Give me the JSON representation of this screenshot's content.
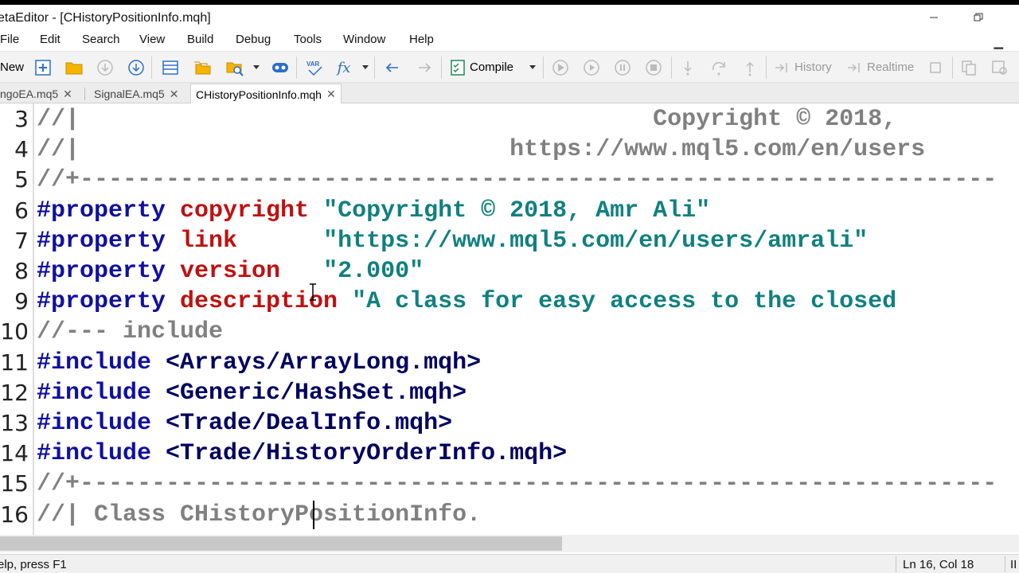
{
  "window": {
    "title": "etaEditor - [CHistoryPositionInfo.mqh]"
  },
  "menu": [
    "File",
    "Edit",
    "Search",
    "View",
    "Build",
    "Debug",
    "Tools",
    "Window",
    "Help"
  ],
  "toolbar": {
    "new_label": "New",
    "compile_label": "Compile",
    "history_label": "History",
    "realtime_label": "Realtime",
    "var_badge": "VAR",
    "fx_badge": "fx"
  },
  "tabs": [
    {
      "label": "ngoEA.mq5",
      "active": false
    },
    {
      "label": "SignalEA.mq5",
      "active": false
    },
    {
      "label": "CHistoryPositionInfo.mqh",
      "active": true
    }
  ],
  "tab_close_glyph": "✕",
  "code_lines": [
    {
      "num": "3",
      "segments": [
        {
          "cls": "cmt",
          "text": "//|                                        Copyright © 2018,"
        }
      ]
    },
    {
      "num": "4",
      "segments": [
        {
          "cls": "cmt",
          "text": "//|                              https://www.mql5.com/en/users"
        }
      ]
    },
    {
      "num": "5",
      "segments": [
        {
          "cls": "cmt",
          "text": "//+----------------------------------------------------------------"
        }
      ]
    },
    {
      "num": "6",
      "segments": [
        {
          "cls": "kw",
          "text": "#property "
        },
        {
          "cls": "pr",
          "text": "copyright "
        },
        {
          "cls": "str",
          "text": "\"Copyright © 2018, Amr Ali\""
        }
      ]
    },
    {
      "num": "7",
      "segments": [
        {
          "cls": "kw",
          "text": "#property "
        },
        {
          "cls": "pr",
          "text": "link      "
        },
        {
          "cls": "str",
          "text": "\"https://www.mql5.com/en/users/amrali\""
        }
      ]
    },
    {
      "num": "8",
      "segments": [
        {
          "cls": "kw",
          "text": "#property "
        },
        {
          "cls": "pr",
          "text": "version   "
        },
        {
          "cls": "str",
          "text": "\"2.000\""
        }
      ]
    },
    {
      "num": "9",
      "segments": [
        {
          "cls": "kw",
          "text": "#property "
        },
        {
          "cls": "pr",
          "text": "description "
        },
        {
          "cls": "str",
          "text": "\"A class for easy access to the closed"
        }
      ]
    },
    {
      "num": "10",
      "segments": [
        {
          "cls": "cmt",
          "text": "//--- include"
        }
      ]
    },
    {
      "num": "11",
      "segments": [
        {
          "cls": "kw",
          "text": "#include "
        },
        {
          "cls": "inc",
          "text": "<Arrays/ArrayLong.mqh>"
        }
      ]
    },
    {
      "num": "12",
      "segments": [
        {
          "cls": "kw",
          "text": "#include "
        },
        {
          "cls": "inc",
          "text": "<Generic/HashSet.mqh>"
        }
      ]
    },
    {
      "num": "13",
      "segments": [
        {
          "cls": "kw",
          "text": "#include "
        },
        {
          "cls": "inc",
          "text": "<Trade/DealInfo.mqh>"
        }
      ]
    },
    {
      "num": "14",
      "segments": [
        {
          "cls": "kw",
          "text": "#include "
        },
        {
          "cls": "inc",
          "text": "<Trade/HistoryOrderInfo.mqh>"
        }
      ]
    },
    {
      "num": "15",
      "segments": [
        {
          "cls": "cmt",
          "text": "//+----------------------------------------------------------------"
        }
      ]
    },
    {
      "num": "16",
      "segments": [
        {
          "cls": "cmt",
          "text": "//| Class CHistoryPositionInfo."
        }
      ]
    }
  ],
  "status": {
    "help_text": "elp, press F1",
    "position": "Ln 16, Col 18",
    "extra": "II"
  }
}
